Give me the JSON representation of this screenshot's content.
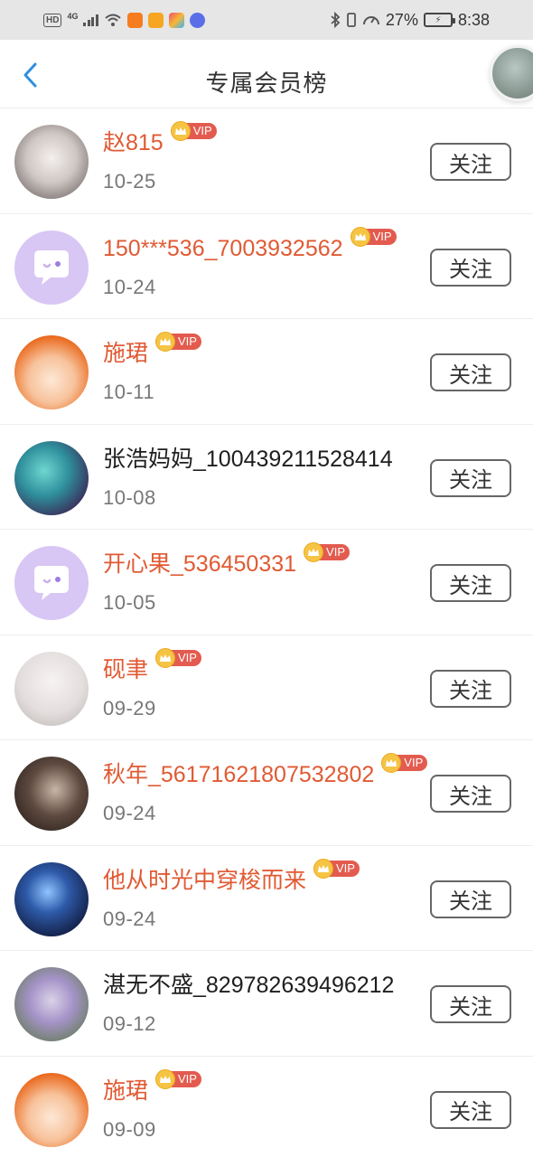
{
  "status_bar": {
    "network_badge": "HD",
    "network_type": "4G",
    "battery_percent": "27%",
    "time": "8:38"
  },
  "header": {
    "title": "专属会员榜",
    "back_icon": "chevron-left-icon"
  },
  "vip_badge_text": "VIP",
  "follow_label": "关注",
  "members": [
    {
      "name": "赵815",
      "date": "10-25",
      "vip": true
    },
    {
      "name": "150***536_7003932562",
      "date": "10-24",
      "vip": true
    },
    {
      "name": "施珺",
      "date": "10-11",
      "vip": true
    },
    {
      "name": "张浩妈妈_100439211528414",
      "date": "10-08",
      "vip": false
    },
    {
      "name": "开心果_536450331",
      "date": "10-05",
      "vip": true
    },
    {
      "name": "砚聿",
      "date": "09-29",
      "vip": true
    },
    {
      "name": "秋年_56171621807532802",
      "date": "09-24",
      "vip": true
    },
    {
      "name": "他从时光中穿梭而来",
      "date": "09-24",
      "vip": true
    },
    {
      "name": "湛无不盛_829782639496212",
      "date": "09-12",
      "vip": false
    },
    {
      "name": "施珺",
      "date": "09-09",
      "vip": true
    }
  ],
  "colors": {
    "vip_name": "#e05a33",
    "normal_name": "#1e1e1e",
    "accent_back": "#2f8fe0",
    "vip_badge": "#e35b4f",
    "crown": "#f6c445"
  }
}
